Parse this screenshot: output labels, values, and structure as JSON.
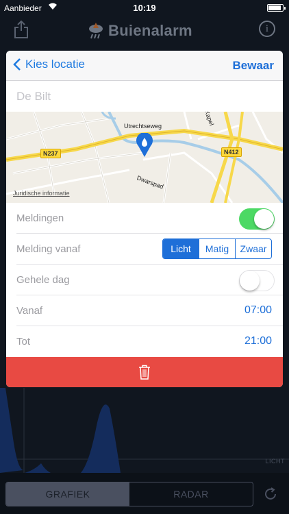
{
  "status_bar": {
    "carrier": "Aanbieder",
    "time": "10:19"
  },
  "header": {
    "logo_text": "Buienalarm"
  },
  "modal": {
    "back_label": "Kies locatie",
    "save_label": "Bewaar",
    "location_placeholder": "De Bilt",
    "map": {
      "legal_label": "Juridische informatie",
      "road_labels": [
        "Utrechtseweg",
        "Dwarspad",
        "Kapel"
      ],
      "shields": [
        "N237",
        "N412"
      ]
    },
    "rows": {
      "notifications_label": "Meldingen",
      "notifications_on": true,
      "level_label": "Melding vanaf",
      "level_options": [
        "Licht",
        "Matig",
        "Zwaar"
      ],
      "level_selected": "Licht",
      "all_day_label": "Gehele dag",
      "all_day_on": false,
      "from_label": "Vanaf",
      "from_value": "07:00",
      "to_label": "Tot",
      "to_value": "21:00"
    }
  },
  "chart": {
    "level_label": "LICHT"
  },
  "bottom_bar": {
    "tab_graph": "GRAFIEK",
    "tab_radar": "RADAR",
    "active_tab": "GRAFIEK"
  },
  "colors": {
    "accent": "#1e6fd8",
    "toggle_on": "#4cd964",
    "delete": "#e84a43"
  }
}
